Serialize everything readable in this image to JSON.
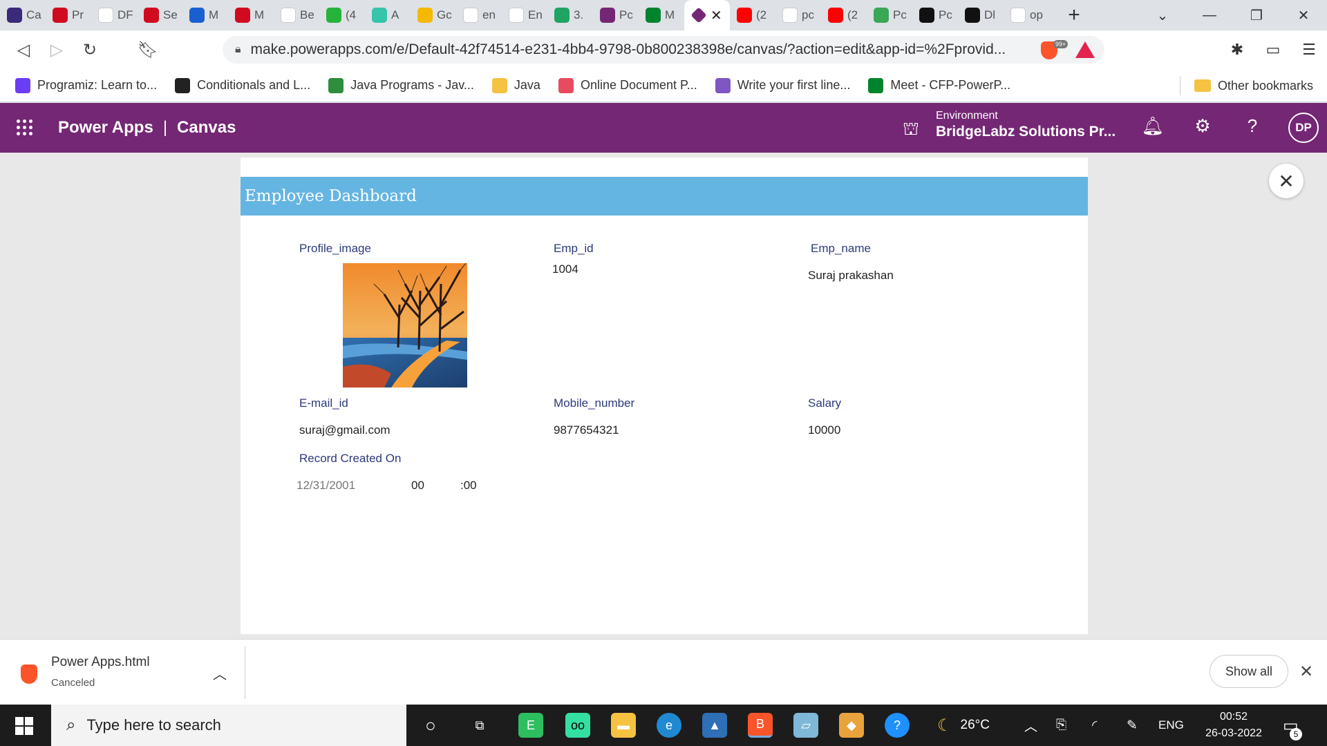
{
  "browser": {
    "tabs": [
      {
        "label": "Ca",
        "color": "#3b2a7a",
        "icon": "app-icon"
      },
      {
        "label": "Pr",
        "color": "#d10b1f",
        "icon": "oracle-icon"
      },
      {
        "label": "DF",
        "color": "#ffffff",
        "icon": "gmail-icon"
      },
      {
        "label": "Se",
        "color": "#d10b1f",
        "icon": "oracle-icon"
      },
      {
        "label": "M",
        "color": "#1a5fd1",
        "icon": "flow-icon"
      },
      {
        "label": "M",
        "color": "#d10b1f",
        "icon": "oracle-icon"
      },
      {
        "label": "Be",
        "color": "#ffffff",
        "icon": "cb-icon"
      },
      {
        "label": "(4",
        "color": "#25b33b",
        "icon": "whatsapp-icon"
      },
      {
        "label": "A",
        "color": "#36c5ab",
        "icon": "slack-icon"
      },
      {
        "label": "Gc",
        "color": "#f6b800",
        "icon": "keep-icon"
      },
      {
        "label": "en",
        "color": "#ffffff",
        "icon": "google-icon"
      },
      {
        "label": "En",
        "color": "#ffffff",
        "icon": "m-icon"
      },
      {
        "label": "3.",
        "color": "#1fa463",
        "icon": "drive-icon"
      },
      {
        "label": "Pc",
        "color": "#742774",
        "icon": "powerapps-icon"
      },
      {
        "label": "M",
        "color": "#00832d",
        "icon": "meet-icon"
      }
    ],
    "active_tab_icon": "powerapps-icon",
    "tabs_after": [
      {
        "label": "(2",
        "color": "#ff0000",
        "icon": "youtube-icon"
      },
      {
        "label": "pc",
        "color": "#ffffff",
        "icon": "google-icon"
      },
      {
        "label": "(2",
        "color": "#ff0000",
        "icon": "youtube-icon"
      },
      {
        "label": "Pc",
        "color": "#3aa757",
        "icon": "sheet-icon"
      },
      {
        "label": "Pc",
        "color": "#111111",
        "icon": "github-icon"
      },
      {
        "label": "Dl",
        "color": "#111111",
        "icon": "github-icon"
      },
      {
        "label": "op",
        "color": "#ffffff",
        "icon": "google-icon"
      }
    ],
    "url": "make.powerapps.com/e/Default-42f74514-e231-4bb4-9798-0b800238398e/canvas/?action=edit&app-id=%2Fprovid...",
    "ext_badge": "99+",
    "bookmarks": [
      {
        "label": "Programiz: Learn to...",
        "color": "#6b3df5"
      },
      {
        "label": "Conditionals and L...",
        "color": "#222222"
      },
      {
        "label": "Java Programs - Jav...",
        "color": "#2f8d3e"
      },
      {
        "label": "Java",
        "color": "#f5c242"
      },
      {
        "label": "Online Document P...",
        "color": "#e84a5f"
      },
      {
        "label": "Write your first line...",
        "color": "#7e57c2"
      },
      {
        "label": "Meet - CFP-PowerP...",
        "color": "#00832d"
      }
    ],
    "other_bookmarks": "Other bookmarks"
  },
  "powerapps": {
    "title": "Power Apps",
    "separator": "|",
    "section": "Canvas",
    "environment_label": "Environment",
    "environment_name": "BridgeLabz Solutions Pr...",
    "avatar_initials": "DP",
    "brand_color": "#742774"
  },
  "app": {
    "title": "Employee Dashboard",
    "title_bar_color": "#65b5e2",
    "labels": {
      "profile_image": "Profile_image",
      "emp_id": "Emp_id",
      "emp_name": "Emp_name",
      "email": "E-mail_id",
      "mobile": "Mobile_number",
      "salary": "Salary",
      "record_created": "Record Created On"
    },
    "values": {
      "emp_id": "1004",
      "emp_name": "Suraj prakashan",
      "email": "suraj@gmail.com",
      "mobile": "9877654321",
      "salary": "10000",
      "date": "12/31/2001",
      "hour": "00",
      "minute": ":00"
    }
  },
  "downloads": {
    "file_name": "Power Apps.html",
    "status": "Canceled",
    "show_all": "Show all"
  },
  "taskbar": {
    "search_placeholder": "Type here to search",
    "weather": "26°C",
    "language": "ENG",
    "time": "00:52",
    "date": "26-03-2022",
    "notification_count": "5"
  }
}
